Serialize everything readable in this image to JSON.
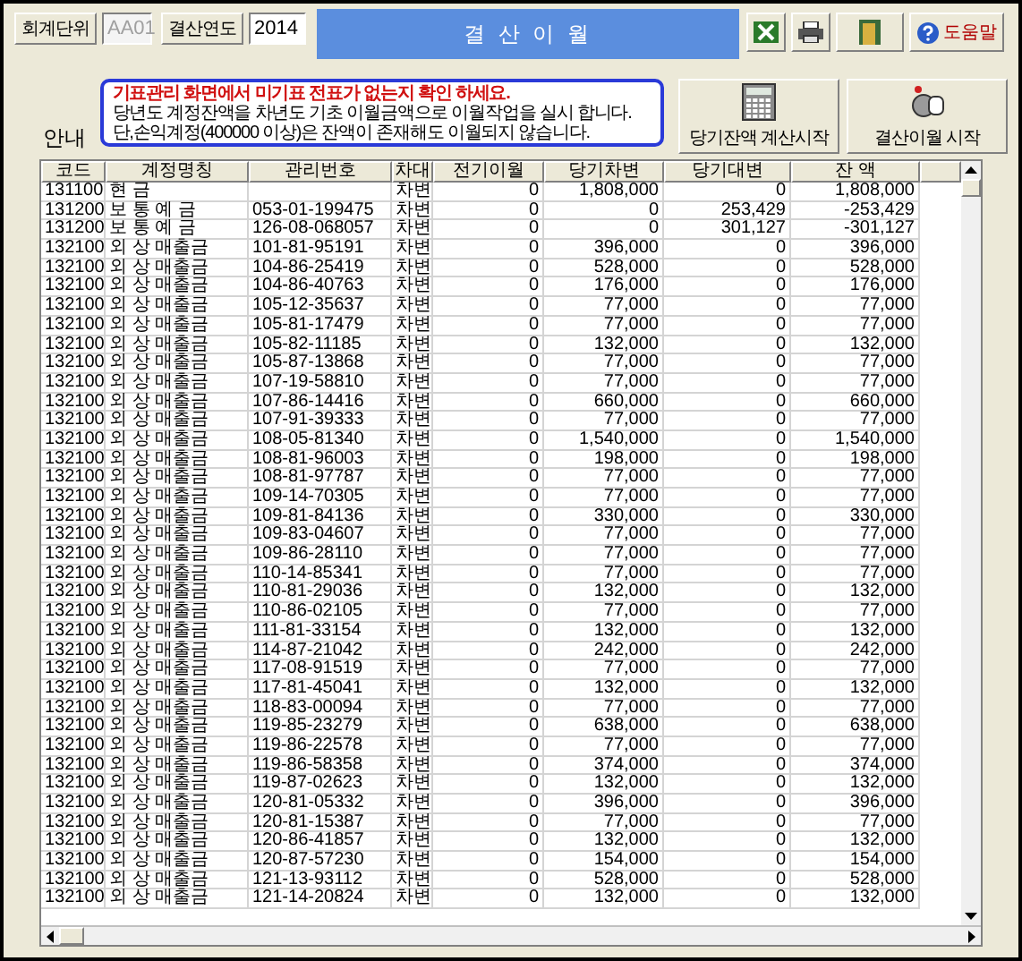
{
  "toolbar": {
    "unit_label": "회계단위",
    "unit_field": {
      "value": "AA01",
      "disabled": true
    },
    "year_label": "결산연도",
    "year_field": {
      "value": "2014",
      "disabled": false
    },
    "title": "결 산 이 월",
    "help_label": "도움말"
  },
  "notice": {
    "label": "안내",
    "lines": [
      {
        "kind": "warning",
        "text": "기표관리 화면에서 미기표 전표가 없는지 확인 하세요."
      },
      {
        "kind": "normal",
        "text": "당년도 계정잔액을 차년도 기초 이월금액으로 이월작업을 실시 합니다."
      },
      {
        "kind": "normal",
        "text": "단,손익계정(400000 이상)은 잔액이 존재해도 이월되지 않습니다."
      }
    ]
  },
  "actions": [
    {
      "kind": "calculate",
      "label": "당기잔액 계산시작"
    },
    {
      "kind": "carryover",
      "label": "결산이월 시작"
    }
  ],
  "table": {
    "columns": [
      "코드",
      "계정명칭",
      "관리번호",
      "차대",
      "전기이월",
      "당기차변",
      "당기대변",
      "잔 액"
    ],
    "rows": [
      [
        "131100",
        "현 금",
        "",
        "차변",
        "0",
        "1,808,000",
        "0",
        "1,808,000"
      ],
      [
        "131200",
        "보 통 예 금",
        "053-01-199475",
        "차변",
        "0",
        "0",
        "253,429",
        "-253,429"
      ],
      [
        "131200",
        "보 통 예 금",
        "126-08-068057",
        "차변",
        "0",
        "0",
        "301,127",
        "-301,127"
      ],
      [
        "132100",
        "외 상 매출금",
        "101-81-95191",
        "차변",
        "0",
        "396,000",
        "0",
        "396,000"
      ],
      [
        "132100",
        "외 상 매출금",
        "104-86-25419",
        "차변",
        "0",
        "528,000",
        "0",
        "528,000"
      ],
      [
        "132100",
        "외 상 매출금",
        "104-86-40763",
        "차변",
        "0",
        "176,000",
        "0",
        "176,000"
      ],
      [
        "132100",
        "외 상 매출금",
        "105-12-35637",
        "차변",
        "0",
        "77,000",
        "0",
        "77,000"
      ],
      [
        "132100",
        "외 상 매출금",
        "105-81-17479",
        "차변",
        "0",
        "77,000",
        "0",
        "77,000"
      ],
      [
        "132100",
        "외 상 매출금",
        "105-82-11185",
        "차변",
        "0",
        "132,000",
        "0",
        "132,000"
      ],
      [
        "132100",
        "외 상 매출금",
        "105-87-13868",
        "차변",
        "0",
        "77,000",
        "0",
        "77,000"
      ],
      [
        "132100",
        "외 상 매출금",
        "107-19-58810",
        "차변",
        "0",
        "77,000",
        "0",
        "77,000"
      ],
      [
        "132100",
        "외 상 매출금",
        "107-86-14416",
        "차변",
        "0",
        "660,000",
        "0",
        "660,000"
      ],
      [
        "132100",
        "외 상 매출금",
        "107-91-39333",
        "차변",
        "0",
        "77,000",
        "0",
        "77,000"
      ],
      [
        "132100",
        "외 상 매출금",
        "108-05-81340",
        "차변",
        "0",
        "1,540,000",
        "0",
        "1,540,000"
      ],
      [
        "132100",
        "외 상 매출금",
        "108-81-96003",
        "차변",
        "0",
        "198,000",
        "0",
        "198,000"
      ],
      [
        "132100",
        "외 상 매출금",
        "108-81-97787",
        "차변",
        "0",
        "77,000",
        "0",
        "77,000"
      ],
      [
        "132100",
        "외 상 매출금",
        "109-14-70305",
        "차변",
        "0",
        "77,000",
        "0",
        "77,000"
      ],
      [
        "132100",
        "외 상 매출금",
        "109-81-84136",
        "차변",
        "0",
        "330,000",
        "0",
        "330,000"
      ],
      [
        "132100",
        "외 상 매출금",
        "109-83-04607",
        "차변",
        "0",
        "77,000",
        "0",
        "77,000"
      ],
      [
        "132100",
        "외 상 매출금",
        "109-86-28110",
        "차변",
        "0",
        "77,000",
        "0",
        "77,000"
      ],
      [
        "132100",
        "외 상 매출금",
        "110-14-85341",
        "차변",
        "0",
        "77,000",
        "0",
        "77,000"
      ],
      [
        "132100",
        "외 상 매출금",
        "110-81-29036",
        "차변",
        "0",
        "132,000",
        "0",
        "132,000"
      ],
      [
        "132100",
        "외 상 매출금",
        "110-86-02105",
        "차변",
        "0",
        "77,000",
        "0",
        "77,000"
      ],
      [
        "132100",
        "외 상 매출금",
        "111-81-33154",
        "차변",
        "0",
        "132,000",
        "0",
        "132,000"
      ],
      [
        "132100",
        "외 상 매출금",
        "114-87-21042",
        "차변",
        "0",
        "242,000",
        "0",
        "242,000"
      ],
      [
        "132100",
        "외 상 매출금",
        "117-08-91519",
        "차변",
        "0",
        "77,000",
        "0",
        "77,000"
      ],
      [
        "132100",
        "외 상 매출금",
        "117-81-45041",
        "차변",
        "0",
        "132,000",
        "0",
        "132,000"
      ],
      [
        "132100",
        "외 상 매출금",
        "118-83-00094",
        "차변",
        "0",
        "77,000",
        "0",
        "77,000"
      ],
      [
        "132100",
        "외 상 매출금",
        "119-85-23279",
        "차변",
        "0",
        "638,000",
        "0",
        "638,000"
      ],
      [
        "132100",
        "외 상 매출금",
        "119-86-22578",
        "차변",
        "0",
        "77,000",
        "0",
        "77,000"
      ],
      [
        "132100",
        "외 상 매출금",
        "119-86-58358",
        "차변",
        "0",
        "374,000",
        "0",
        "374,000"
      ],
      [
        "132100",
        "외 상 매출금",
        "119-87-02623",
        "차변",
        "0",
        "132,000",
        "0",
        "132,000"
      ],
      [
        "132100",
        "외 상 매출금",
        "120-81-05332",
        "차변",
        "0",
        "396,000",
        "0",
        "396,000"
      ],
      [
        "132100",
        "외 상 매출금",
        "120-81-15387",
        "차변",
        "0",
        "77,000",
        "0",
        "77,000"
      ],
      [
        "132100",
        "외 상 매출금",
        "120-86-41857",
        "차변",
        "0",
        "132,000",
        "0",
        "132,000"
      ],
      [
        "132100",
        "외 상 매출금",
        "120-87-57230",
        "차변",
        "0",
        "154,000",
        "0",
        "154,000"
      ],
      [
        "132100",
        "외 상 매출금",
        "121-13-93112",
        "차변",
        "0",
        "528,000",
        "0",
        "528,000"
      ],
      [
        "132100",
        "외 상 매출금",
        "121-14-20824",
        "차변",
        "0",
        "132,000",
        "0",
        "132,000"
      ]
    ]
  }
}
